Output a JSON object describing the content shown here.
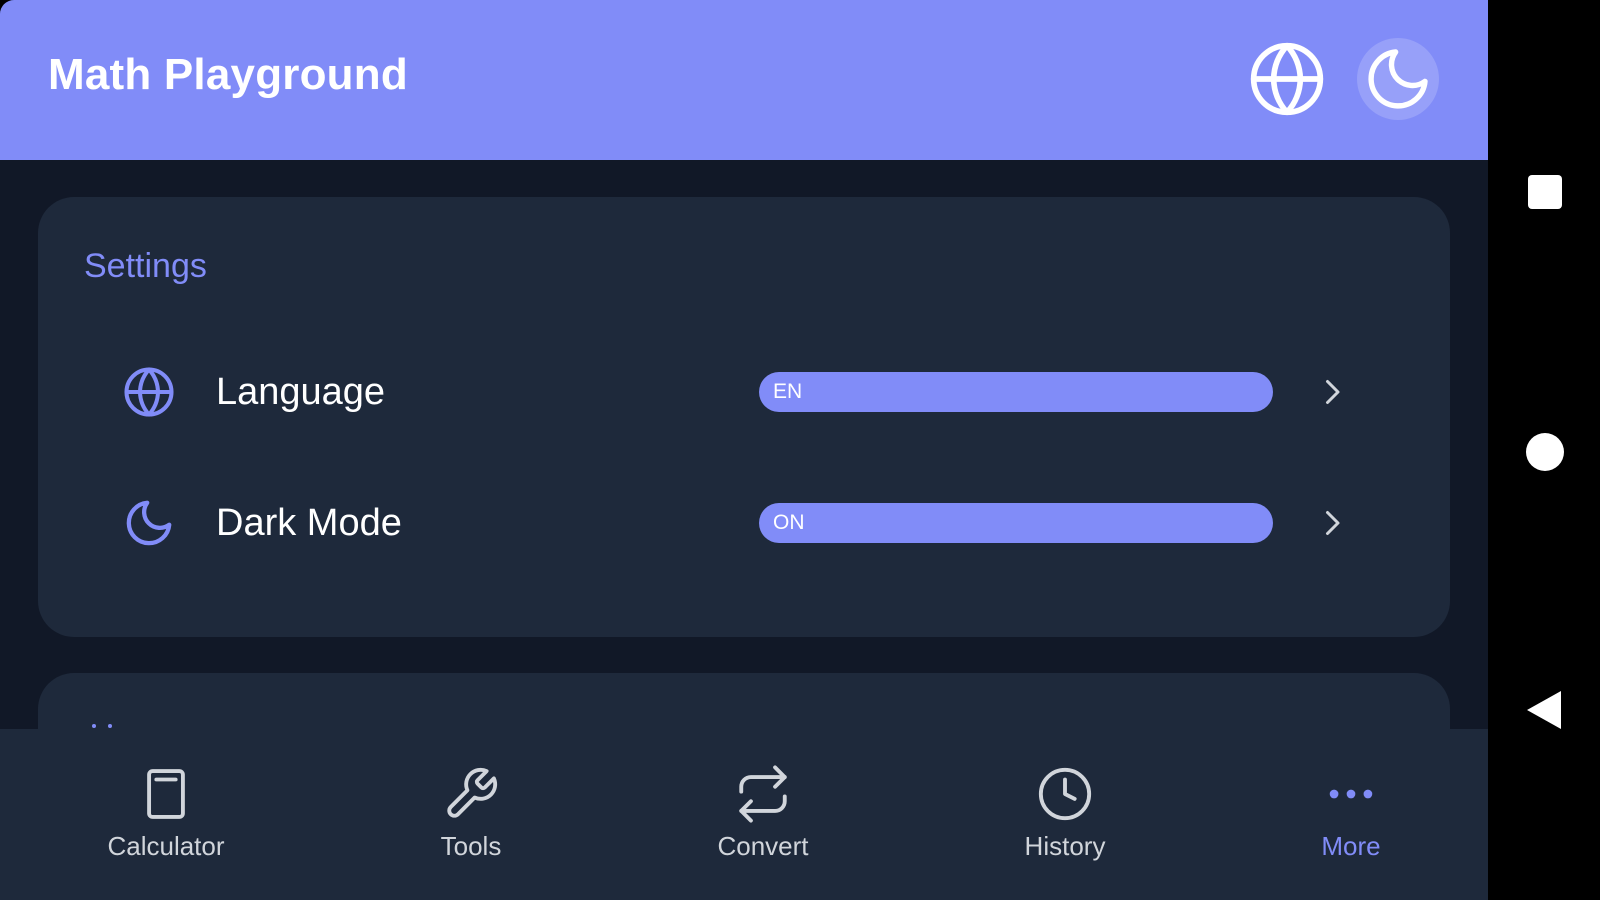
{
  "app": {
    "title": "Math Playground",
    "accent_color": "#818cf8",
    "background_color": "#111827",
    "card_color": "#1e293b"
  },
  "header": {
    "language_button_icon": "globe-icon",
    "theme_button_icon": "moon-icon"
  },
  "settings": {
    "title": "Settings",
    "rows": [
      {
        "icon": "globe-icon",
        "label": "Language",
        "value": "EN",
        "chevron": "chevron-right-icon"
      },
      {
        "icon": "moon-icon",
        "label": "Dark Mode",
        "value": "ON",
        "chevron": "chevron-right-icon"
      }
    ]
  },
  "bottom_nav": {
    "items": [
      {
        "label": "Calculator",
        "icon": "calculator-icon",
        "active": false
      },
      {
        "label": "Tools",
        "icon": "wrench-icon",
        "active": false
      },
      {
        "label": "Convert",
        "icon": "swap-arrows-icon",
        "active": false
      },
      {
        "label": "History",
        "icon": "clock-icon",
        "active": false
      },
      {
        "label": "More",
        "icon": "more-horizontal-icon",
        "active": true
      }
    ]
  },
  "system_nav": {
    "buttons": [
      "recents-square-icon",
      "home-circle-icon",
      "back-triangle-icon"
    ]
  }
}
